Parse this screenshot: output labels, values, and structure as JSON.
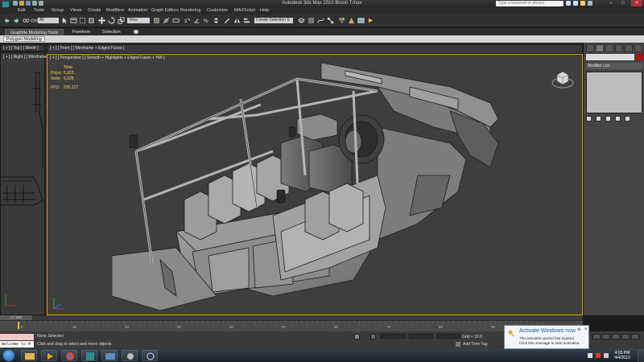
{
  "window": {
    "title": "Autodesk 3ds Max 2010        Brush T.max",
    "search_placeholder": "Type a keyword or phrase",
    "minimize": "–",
    "maximize": "□",
    "close": "✕"
  },
  "menu": [
    "Edit",
    "Tools",
    "Group",
    "Views",
    "Create",
    "Modifiers",
    "Animation",
    "Graph Editors",
    "Rendering",
    "Customize",
    "MAXScript",
    "Help"
  ],
  "toolbar": {
    "filter_select": "All",
    "viewport_select": "View",
    "selection_set": "Create Selection S"
  },
  "ribbon": {
    "tabs": [
      "Graphite Modeling Tools",
      "Freeform",
      "Selection"
    ],
    "panel_label": "Polygon Modeling"
  },
  "viewports": {
    "top_label": "[ + ] [ Top ] [ Wirefr ]",
    "front_label": "[ + ] [ Front ] [ Wireframe + Edged Faces ]",
    "left_label": "[ + ] [ Right ] [ Wireframe ]",
    "persp_label": "[ + ] [ Perspective ] [ Smooth + Highlights + Edged Faces + HW ]"
  },
  "stats": {
    "header": "Total",
    "polys_label": "Polys:",
    "polys_value": "5,923",
    "verts_label": "Verts:",
    "verts_value": "6,925",
    "fps_label": "FPS:",
    "fps_value": "235.227"
  },
  "command_panel": {
    "modifier_list": "Modifier List"
  },
  "timeline": {
    "frame": "0 / 100",
    "ticks": [
      "0",
      "10",
      "20",
      "30",
      "40",
      "50",
      "60",
      "70",
      "80",
      "90",
      "100"
    ]
  },
  "statusbar": {
    "listener": "Welcome to M",
    "selection": "None Selected",
    "prompt": "Click and drag to select and move objects",
    "grid": "Grid = 10.0",
    "add_time_tag": "Add Time Tag"
  },
  "toast": {
    "title": "Activate Windows now",
    "line1": "The activation period has expired.",
    "line2": "Click this message to start activation."
  },
  "clock": {
    "time": "4:03 PM",
    "date": "4/4/2012"
  },
  "colors": {
    "viewport_active_border": "#e0a000",
    "stats_text": "#ffd24a",
    "object_color": "#c80000"
  }
}
